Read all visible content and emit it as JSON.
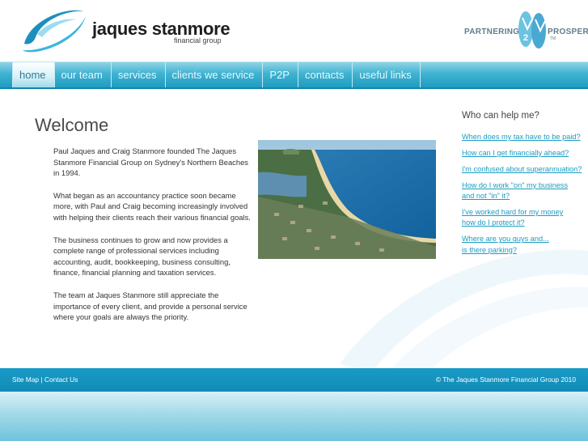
{
  "header": {
    "logo_name": "jaques stanmore",
    "logo_sub": "financial group",
    "partner_left": "PARTNERING",
    "partner_right": "PROSPER",
    "partner_tm": "TM"
  },
  "nav": {
    "items": [
      {
        "label": "home",
        "active": true
      },
      {
        "label": "our team"
      },
      {
        "label": "services"
      },
      {
        "label": "clients we service"
      },
      {
        "label": "P2P"
      },
      {
        "label": "contacts"
      },
      {
        "label": "useful links"
      }
    ]
  },
  "main": {
    "title": "Welcome",
    "paragraphs": [
      "Paul Jaques and Craig Stanmore founded The Jaques Stanmore Financial Group on Sydney's Northern Beaches in 1994.",
      "What began as an accountancy practice soon became more, with Paul and Craig becoming increasingly involved with helping their clients reach their various financial goals.",
      "The business continues to grow and now provides a complete range of professional services including accounting, audit, bookkeeping, business consulting, finance, financial planning and taxation services.",
      "The team at Jaques Stanmore still appreciate the importance of every client, and provide a personal service where your goals are always the priority."
    ]
  },
  "sidebar": {
    "title": "Who can help me?",
    "links": [
      "When does my tax have to be paid?",
      "How can I get financially ahead?",
      "I'm confused about superannuation?",
      "How do I work \"on\" my business\nand not \"in\" it?",
      "I've worked hard for my money\nhow do I protect it?",
      "Where are you guys and...\nis there parking?"
    ]
  },
  "footer": {
    "sitemap": "Site Map",
    "separator": "|",
    "contact": "Contact Us",
    "copyright": "© The Jaques Stanmore Financial Group 2010"
  },
  "colors": {
    "accent": "#1b9bc2",
    "nav": "#40b3d2",
    "footer": "#1a9bc7"
  }
}
